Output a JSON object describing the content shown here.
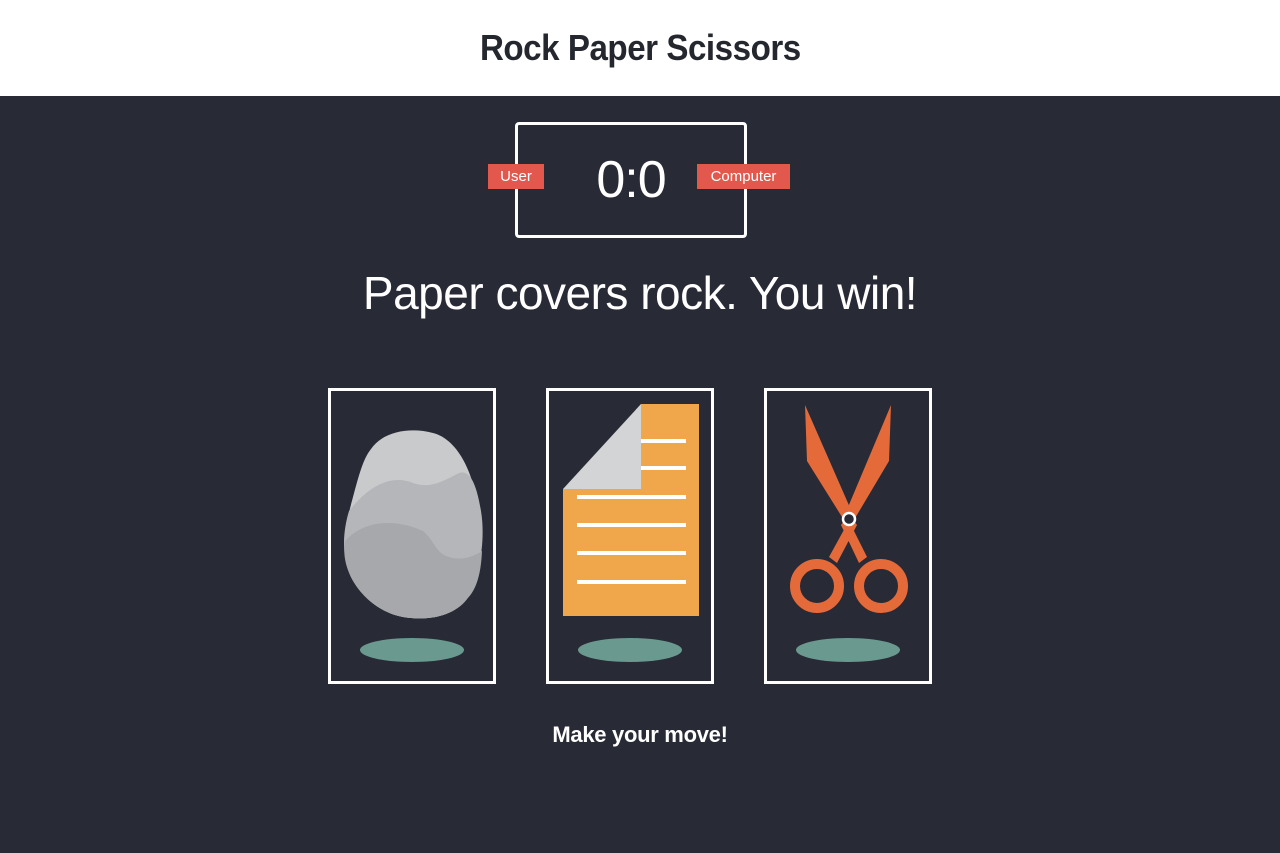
{
  "header": {
    "title": "Rock Paper Scissors"
  },
  "scoreboard": {
    "score": "0:0",
    "user_label": "User",
    "computer_label": "Computer",
    "badge_color": "#e2584d"
  },
  "result": {
    "message": "Paper covers rock. You win!"
  },
  "choices": [
    {
      "id": "rock",
      "icon": "rock-icon"
    },
    {
      "id": "paper",
      "icon": "paper-icon"
    },
    {
      "id": "scissors",
      "icon": "scissors-icon"
    }
  ],
  "prompt": "Make your move!",
  "colors": {
    "background": "#282a35",
    "header_bg": "#ffffff",
    "shadow": "#6a9990",
    "paper": "#f0a64b",
    "scissors": "#e56a3a",
    "rock": "#b3b5b8"
  }
}
